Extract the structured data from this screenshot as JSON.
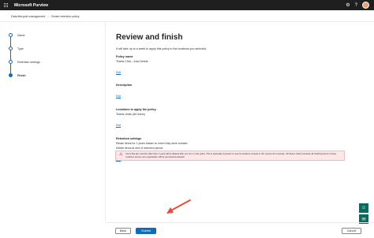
{
  "header": {
    "app_title": "Microsoft Purview",
    "icons": [
      "waffle-icon",
      "gear-icon",
      "help-icon",
      "avatar"
    ]
  },
  "breadcrumb": {
    "items": [
      "Data lifecycle management",
      "Create retention policy"
    ]
  },
  "stepper": {
    "steps": [
      {
        "label": "Name",
        "state": "done"
      },
      {
        "label": "Type",
        "state": "done"
      },
      {
        "label": "Retention settings",
        "state": "done"
      },
      {
        "label": "Finish",
        "state": "current"
      }
    ]
  },
  "main": {
    "title": "Review and finish",
    "intro": "It will take up to a week to apply this policy to the locations you selected.",
    "sections": [
      {
        "heading": "Policy name",
        "lines": [
          "Teams Chat – Auto Delete"
        ],
        "edit": "Edit"
      },
      {
        "heading": "Description",
        "lines": [],
        "edit": "Edit"
      },
      {
        "heading": "Locations to apply the policy",
        "lines": [
          "Teams chats (All Users)"
        ],
        "edit": "Edit"
      },
      {
        "heading": "Retention settings",
        "lines": [
          "Retain items for 1 years based on when they were created",
          "Delete items at end of retention period"
        ],
        "edit": "Edit"
      }
    ],
    "warning": "Items that are currently older than 1 years will be deleted after you turn on this policy. This is especially important to note for locations scoped to 'All' sources (for example, 'All Teams chats') because all matching items in those locations across your organization will be permanently deleted."
  },
  "footer": {
    "back_label": "Back",
    "submit_label": "Submit",
    "cancel_label": "Cancel"
  },
  "colors": {
    "accent": "#0f6cbd",
    "topbar": "#1f1f1f",
    "warning_bg": "#fde7e9",
    "arrow": "#e74c3c"
  }
}
